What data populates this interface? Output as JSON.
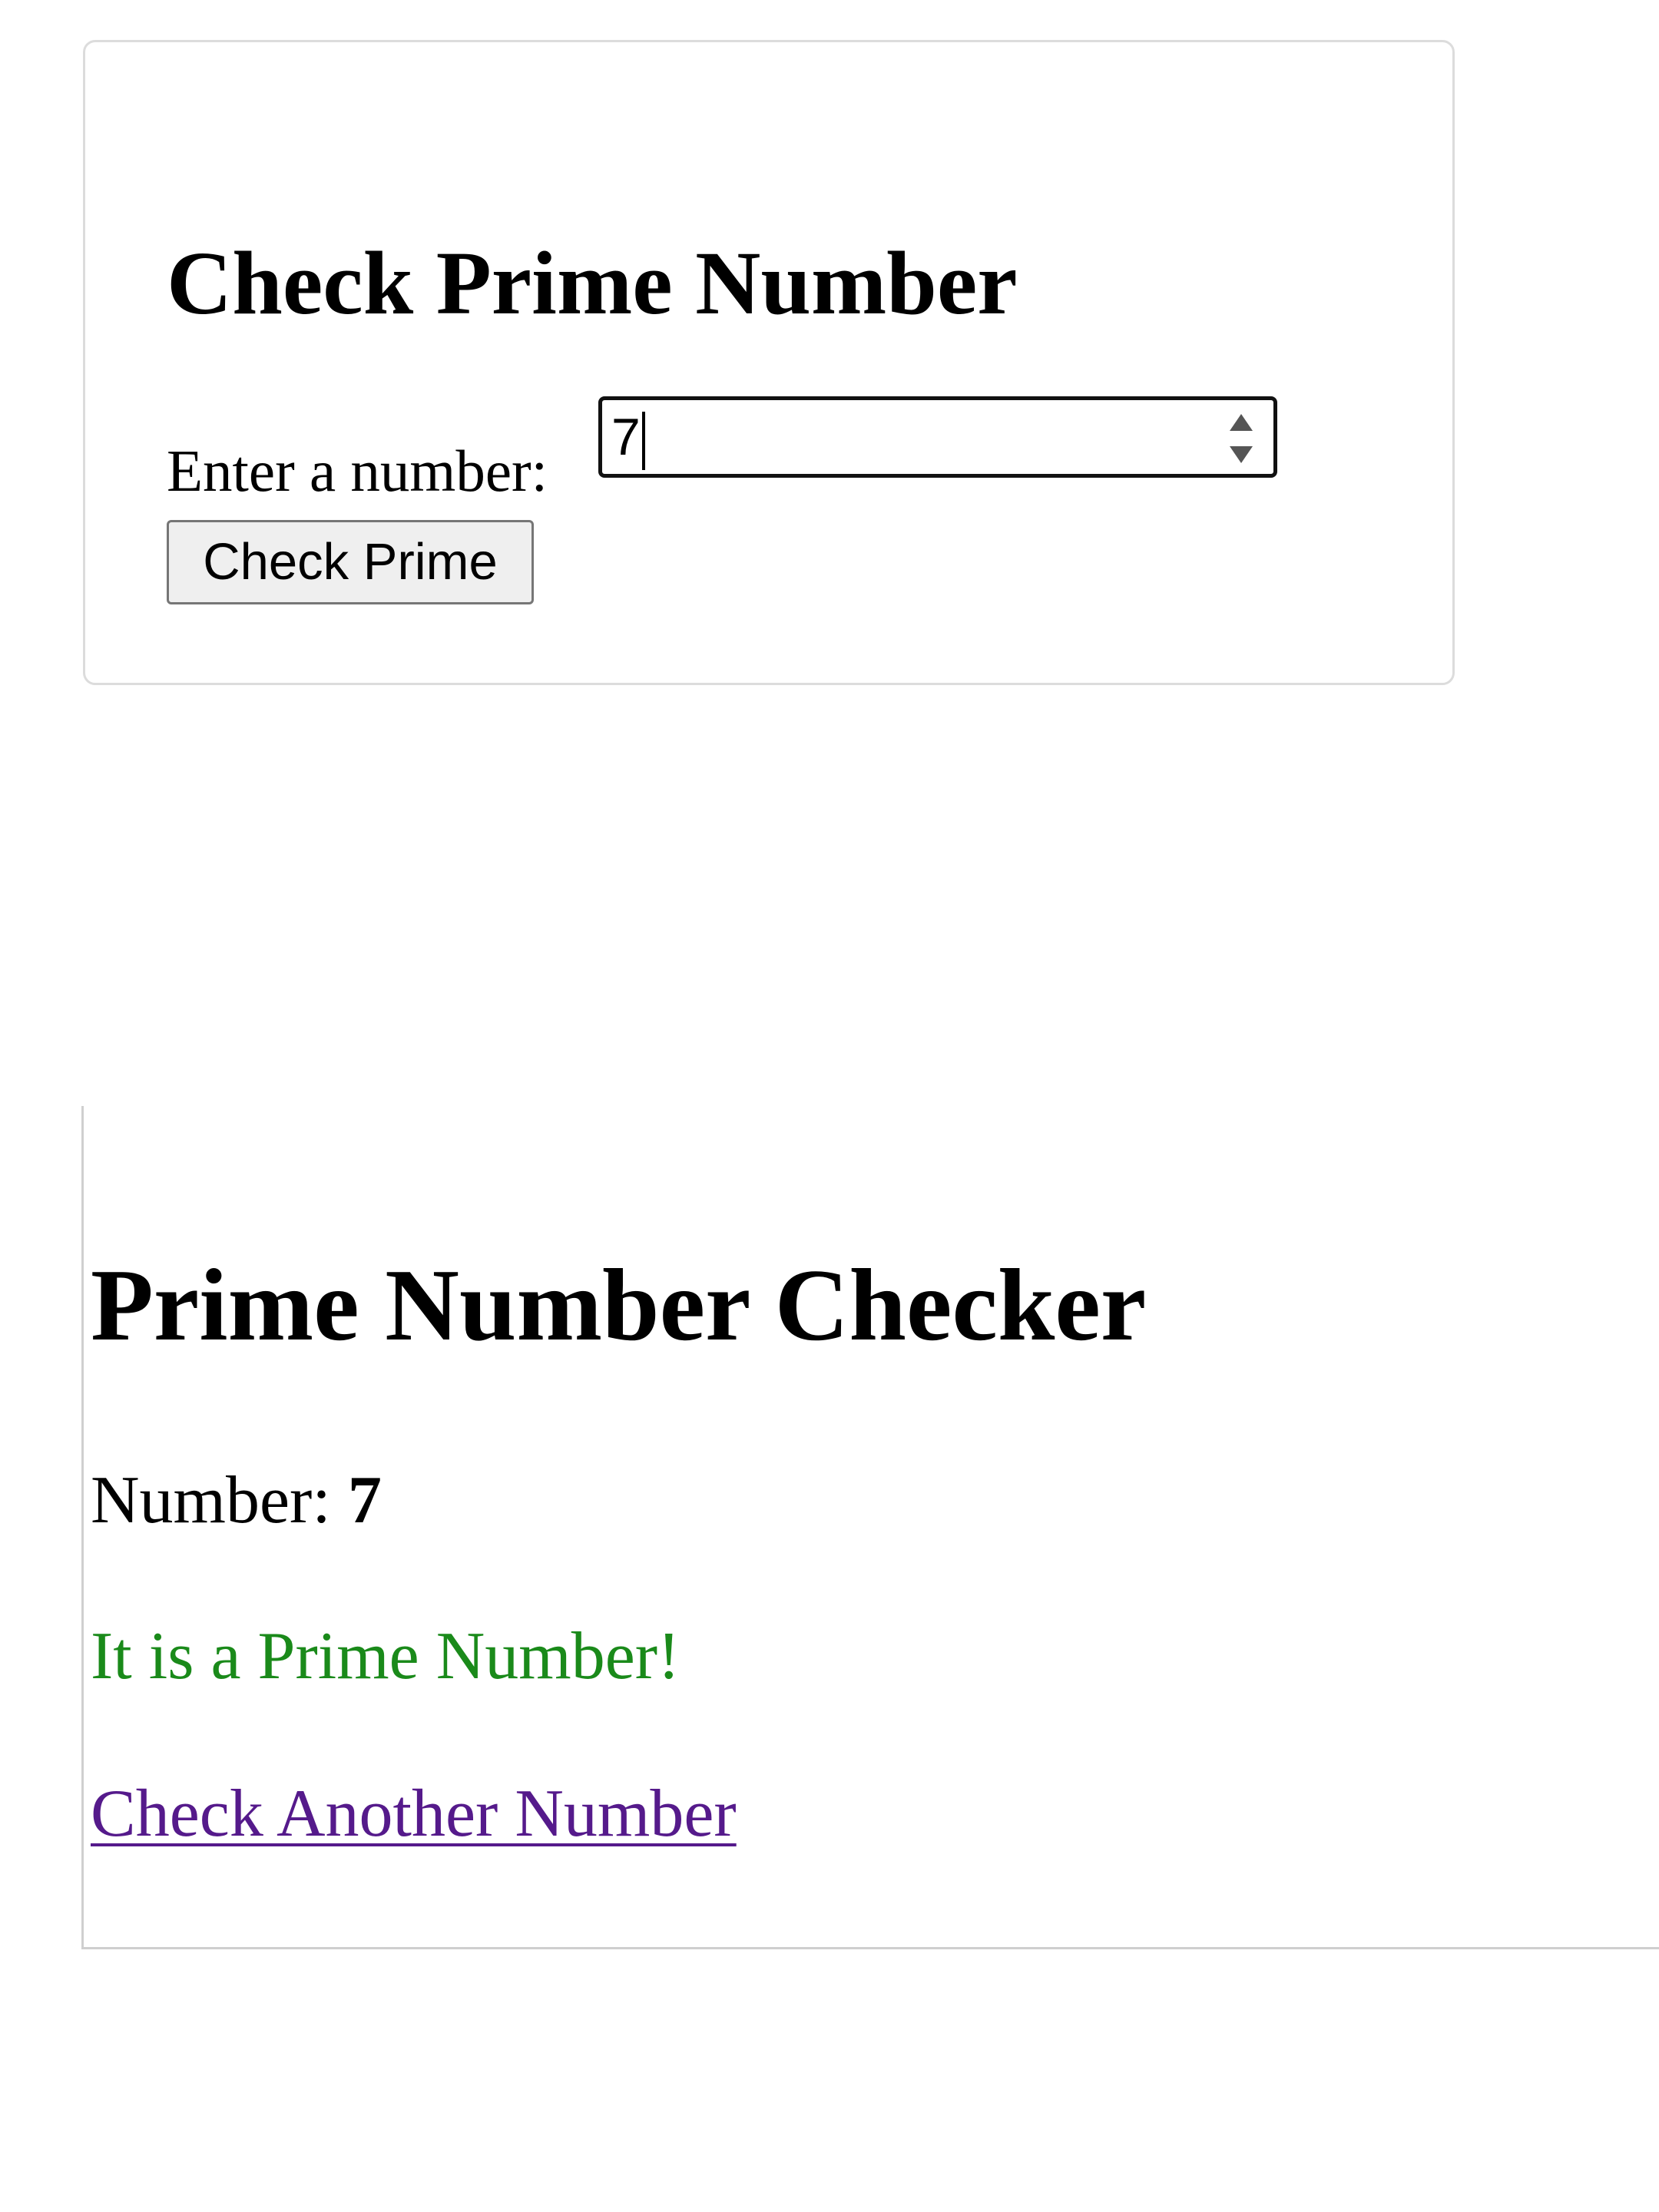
{
  "colors": {
    "success_text": "#1a8a1a",
    "visited_link": "#551a8b"
  },
  "form": {
    "title": "Check Prime Number",
    "label": "Enter a number:",
    "input_value": "7",
    "spinner_icon": "spinner-arrows-icon",
    "submit_label": "Check Prime"
  },
  "result": {
    "title": "Prime Number Checker",
    "number_label": "Number:",
    "number_value": "7",
    "message": "It is a Prime Number!",
    "link_label": "Check Another Number"
  }
}
